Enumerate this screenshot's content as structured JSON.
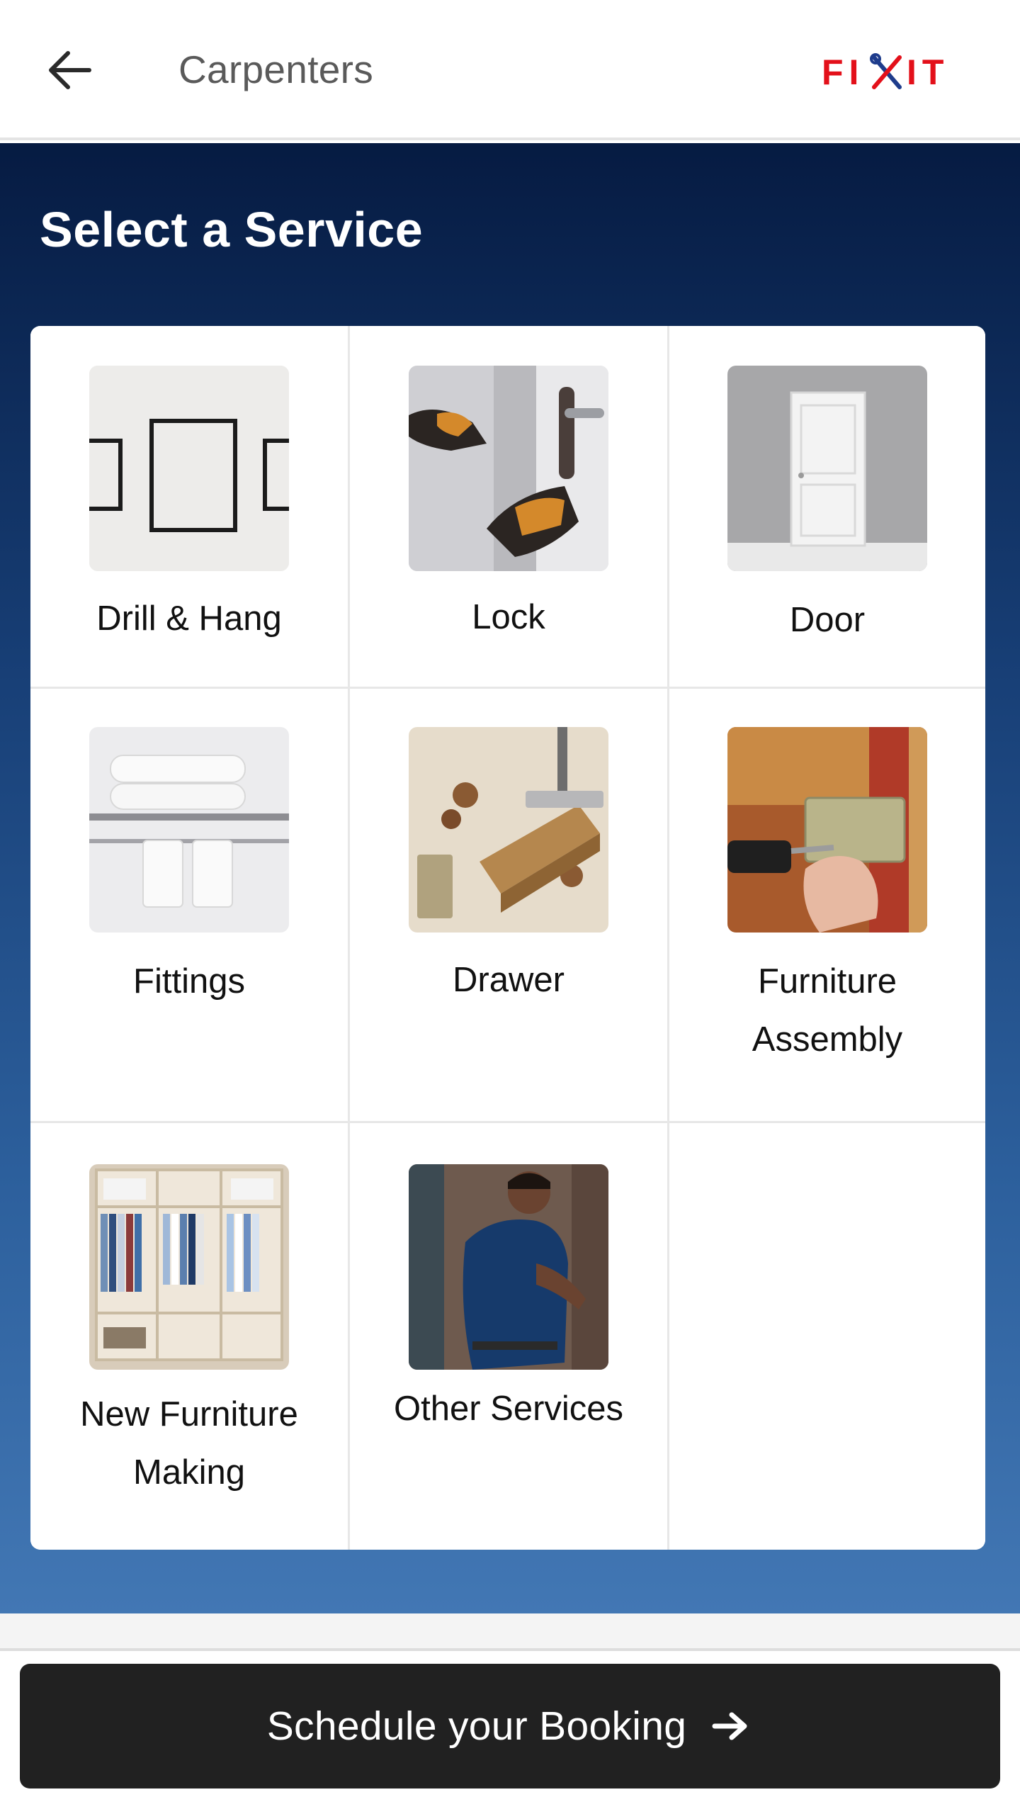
{
  "appbar": {
    "title": "Carpenters",
    "back_icon": "arrow-left-icon",
    "logo_text": "FIXIT"
  },
  "section": {
    "title": "Select a Service"
  },
  "services": [
    {
      "label": "Drill & Hang",
      "icon": "picture-frames-image"
    },
    {
      "label": "Lock",
      "icon": "door-lock-image"
    },
    {
      "label": "Door",
      "icon": "door-image"
    },
    {
      "label": "Fittings",
      "icon": "towel-rack-image"
    },
    {
      "label": "Drawer",
      "icon": "drawer-hinge-image"
    },
    {
      "label": "Furniture\nAssembly",
      "icon": "furniture-assembly-image"
    },
    {
      "label": "New Furniture\nMaking",
      "icon": "wardrobe-image"
    },
    {
      "label": "Other Services",
      "icon": "carpenter-worker-image"
    }
  ],
  "booking": {
    "label": "Schedule your Booking",
    "icon": "arrow-right-icon"
  },
  "colors": {
    "brand_red": "#e3101a",
    "section_top": "#061b42",
    "section_bottom": "#4277b4",
    "button_bg": "#212121"
  }
}
